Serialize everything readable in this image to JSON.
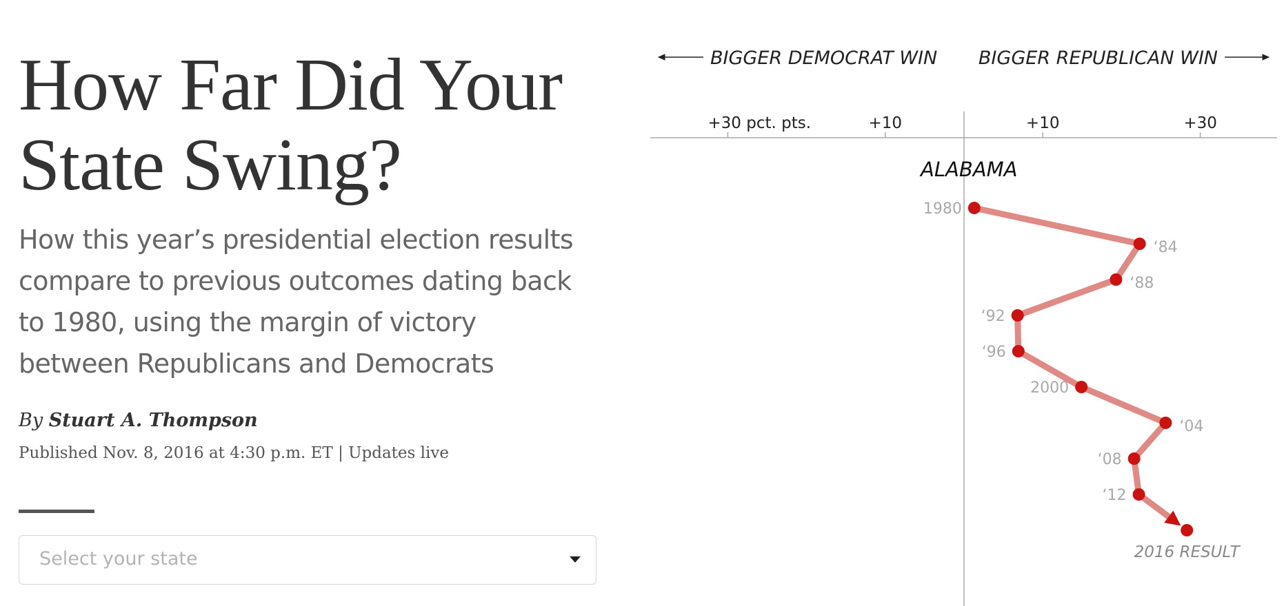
{
  "article": {
    "headline_line1": "How Far Did Your",
    "headline_line2": "State Swing?",
    "summary": "How this year’s presidential election results compare to previous outcomes dating back to 1980, using the margin of victory between Republicans and Democrats",
    "byline_prefix": "By",
    "author": "Stuart A. Thompson",
    "dateline": "Published Nov. 8, 2016 at 4:30 p.m. ET | Updates live"
  },
  "state_select": {
    "placeholder": "Select your state"
  },
  "chart_data": {
    "type": "line",
    "direction_labels": {
      "left": "BIGGER DEMOCRAT WIN",
      "right": "BIGGER REPUBLICAN WIN"
    },
    "state": "ALABAMA",
    "x_axis": {
      "min": -40,
      "max": 40,
      "ticks": [
        {
          "value": -30,
          "label": "+30 pct. pts."
        },
        {
          "value": -10,
          "label": "+10"
        },
        {
          "value": 10,
          "label": "+10"
        },
        {
          "value": 30,
          "label": "+30"
        }
      ]
    },
    "points": [
      {
        "year": 1980,
        "label": "1980",
        "margin": 1.3,
        "label_side": "left"
      },
      {
        "year": 1984,
        "label": "‘84",
        "margin": 22.3,
        "label_side": "right"
      },
      {
        "year": 1988,
        "label": "‘88",
        "margin": 19.3,
        "label_side": "right"
      },
      {
        "year": 1992,
        "label": "‘92",
        "margin": 6.8,
        "label_side": "left"
      },
      {
        "year": 1996,
        "label": "‘96",
        "margin": 6.9,
        "label_side": "left"
      },
      {
        "year": 2000,
        "label": "2000",
        "margin": 14.9,
        "label_side": "left"
      },
      {
        "year": 2004,
        "label": "‘04",
        "margin": 25.6,
        "label_side": "right"
      },
      {
        "year": 2008,
        "label": "‘08",
        "margin": 21.6,
        "label_side": "left"
      },
      {
        "year": 2012,
        "label": "‘12",
        "margin": 22.2,
        "label_side": "left"
      },
      {
        "year": 2016,
        "label": "2016 RESULT",
        "margin": 28.3,
        "label_side": "below"
      }
    ],
    "colors": {
      "line": "#e08a86",
      "point": "#cc1111",
      "axis": "#aaaaaa",
      "year_label": "#a9a9a9",
      "result_label": "#888888"
    }
  }
}
